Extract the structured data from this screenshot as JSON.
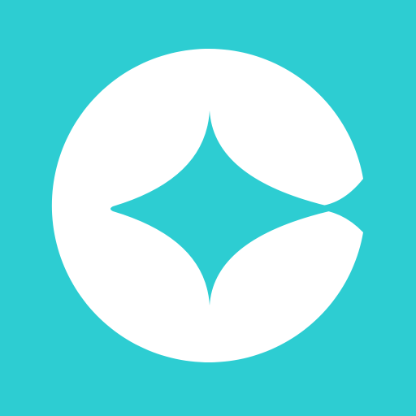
{
  "icon": {
    "name": "sparkle-circle-logo",
    "background_color": "#2dcdd2",
    "mark_color": "#ffffff"
  }
}
